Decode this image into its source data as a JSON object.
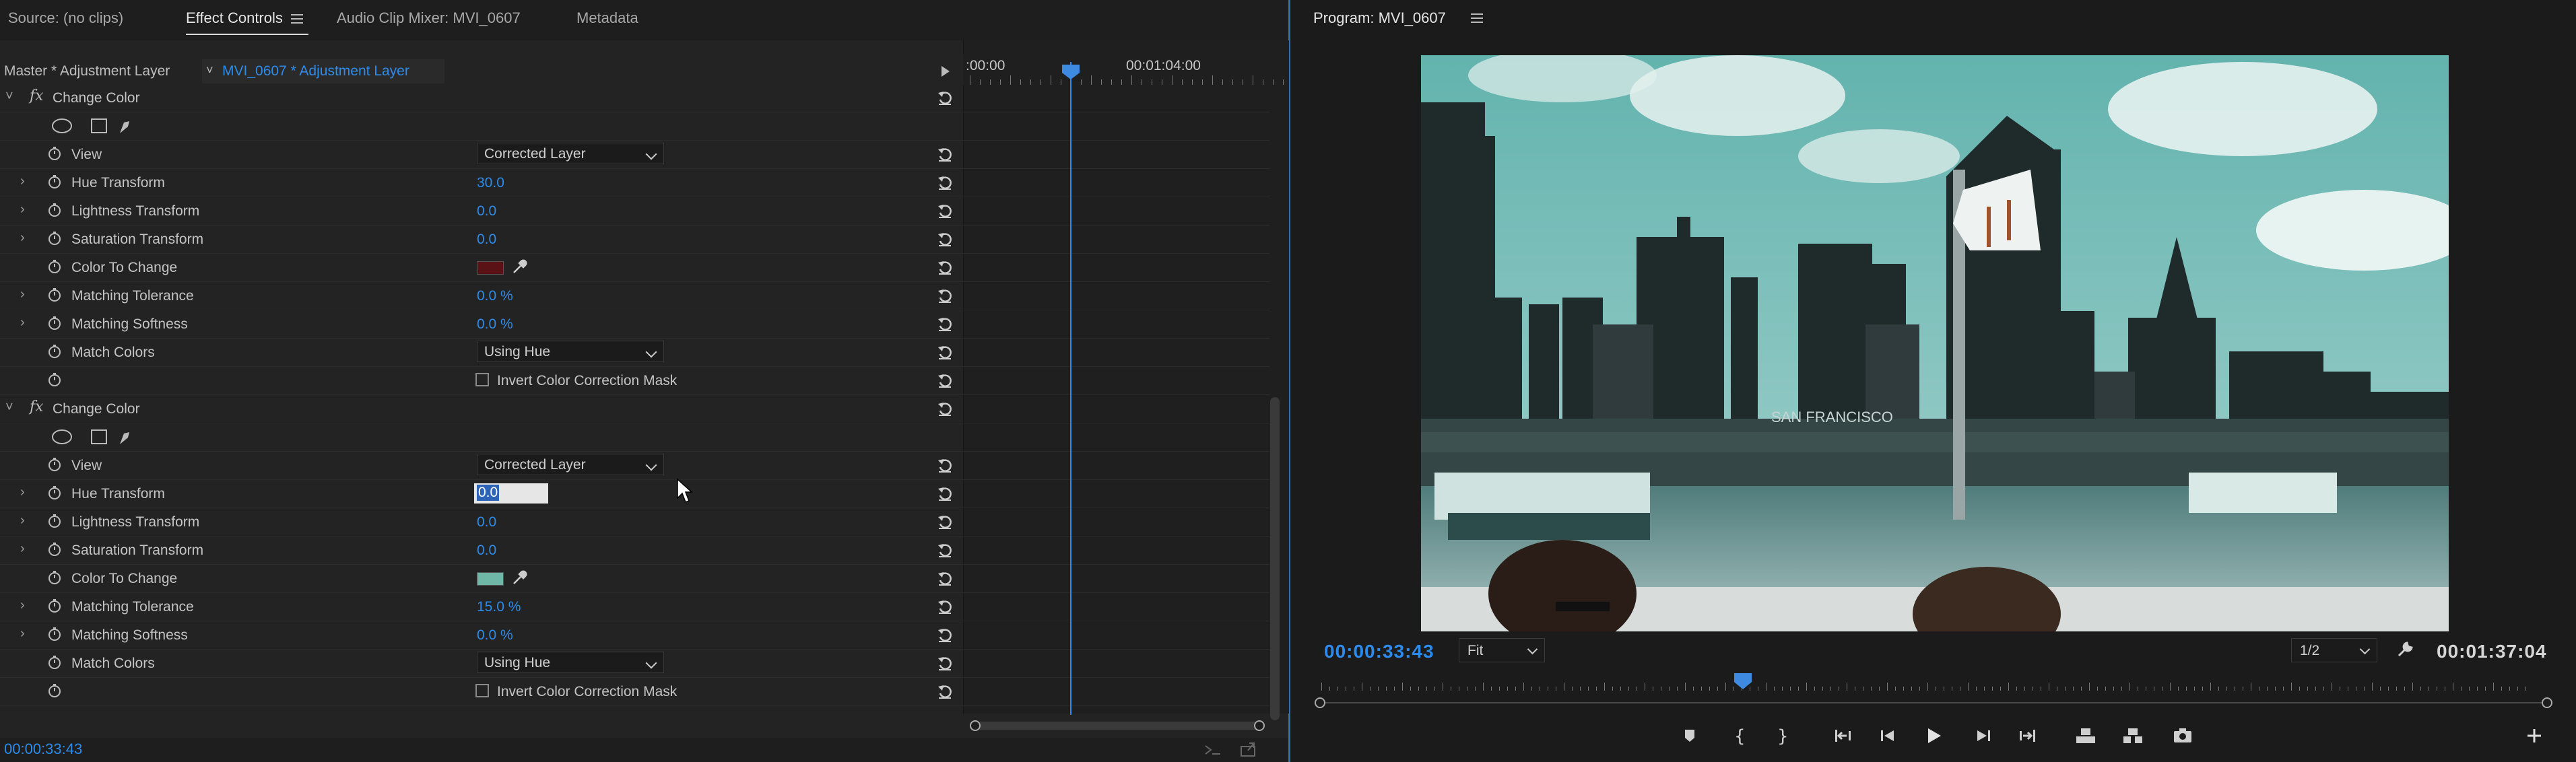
{
  "tabs": {
    "source": "Source: (no clips)",
    "effect_controls": "Effect Controls",
    "audio_mixer": "Audio Clip Mixer: MVI_0607",
    "metadata": "Metadata"
  },
  "source_row": {
    "master": "Master * Adjustment Layer",
    "clip": "MVI_0607 * Adjustment Layer"
  },
  "mini_timeline": {
    "start_label": ":00:00",
    "mid_label": "00:01:04:00"
  },
  "effect1": {
    "name": "Change Color",
    "rows": [
      {
        "label": "View",
        "type": "dropdown",
        "value": "Corrected Layer"
      },
      {
        "label": "Hue Transform",
        "type": "number",
        "value": "30.0"
      },
      {
        "label": "Lightness Transform",
        "type": "number",
        "value": "0.0"
      },
      {
        "label": "Saturation Transform",
        "type": "number",
        "value": "0.0"
      },
      {
        "label": "Color To Change",
        "type": "color",
        "value": "#5a1216"
      },
      {
        "label": "Matching Tolerance",
        "type": "number",
        "value": "0.0 %"
      },
      {
        "label": "Matching Softness",
        "type": "number",
        "value": "0.0 %"
      },
      {
        "label": "Match Colors",
        "type": "dropdown",
        "value": "Using Hue"
      },
      {
        "label": "Invert Color Correction Mask",
        "type": "checkbox",
        "checked": false
      }
    ]
  },
  "effect2": {
    "name": "Change Color",
    "rows": [
      {
        "label": "View",
        "type": "dropdown",
        "value": "Corrected Layer"
      },
      {
        "label": "Hue Transform",
        "type": "editing",
        "value": "0.0"
      },
      {
        "label": "Lightness Transform",
        "type": "number",
        "value": "0.0"
      },
      {
        "label": "Saturation Transform",
        "type": "number",
        "value": "0.0"
      },
      {
        "label": "Color To Change",
        "type": "color",
        "value": "#6fb8a8"
      },
      {
        "label": "Matching Tolerance",
        "type": "number",
        "value": "15.0 %"
      },
      {
        "label": "Matching Softness",
        "type": "number",
        "value": "0.0 %"
      },
      {
        "label": "Match Colors",
        "type": "dropdown",
        "value": "Using Hue"
      },
      {
        "label": "Invert Color Correction Mask",
        "type": "checkbox",
        "checked": false
      }
    ]
  },
  "footer_left": {
    "timecode": "00:00:33:43"
  },
  "program": {
    "title": "Program: MVI_0607",
    "current_timecode": "00:00:33:43",
    "zoom": "Fit",
    "resolution": "1/2",
    "duration": "00:01:37:04",
    "video_text": "SAN FRANCISCO"
  },
  "colors": {
    "accent": "#2d8ceb",
    "panel_bg": "#232323",
    "monitor_bg": "#1b1b1b"
  },
  "icons": {
    "transport": [
      "marker-icon",
      "mark-in-icon",
      "mark-out-icon",
      "go-to-in-icon",
      "step-back-icon",
      "play-icon",
      "step-forward-icon",
      "go-to-out-icon",
      "lift-icon",
      "extract-icon",
      "export-frame-icon",
      "add-button-icon"
    ]
  }
}
